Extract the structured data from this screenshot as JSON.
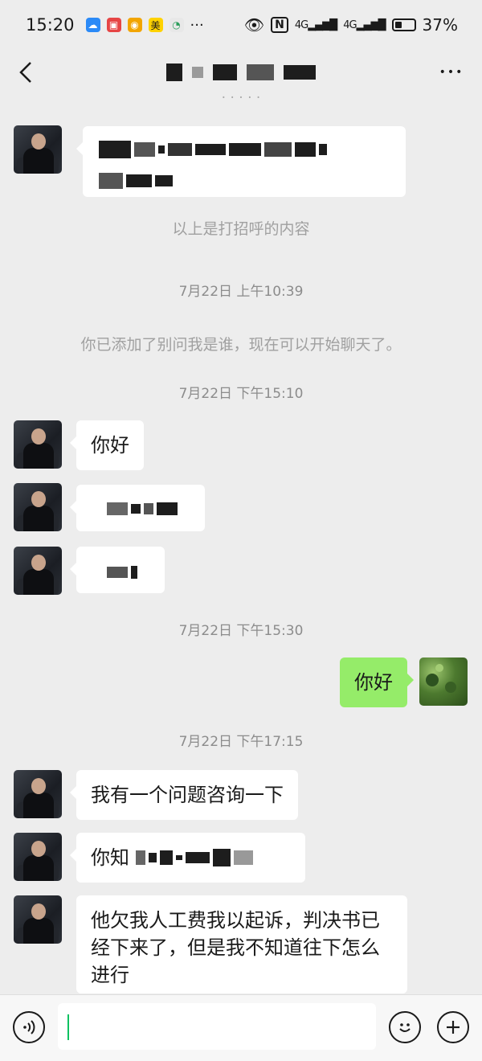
{
  "status_bar": {
    "time": "15:20",
    "app_badge": "美",
    "dots": "···",
    "nfc": "N",
    "signal1": "4G",
    "signal2": "4G",
    "battery_percent": "37%",
    "battery_level": 0.37
  },
  "header": {
    "back_icon": "chevron-left-icon",
    "more_label": "•••"
  },
  "messages": {
    "greeting_note": "以上是打招呼的内容",
    "time_1": "7月22日 上午10:39",
    "system_added": "你已添加了别问我是谁，现在可以开始聊天了。",
    "time_2": "7月22日 下午15:10",
    "msg_hello": "你好",
    "time_3": "7月22日 下午15:30",
    "msg_my_hello": "你好",
    "time_4": "7月22日 下午17:15",
    "msg_question": "我有一个问题咨询一下",
    "msg_know_prefix": "你知",
    "msg_wages": "他欠我人工费我以起诉，判决书已经下来了，但是我不知道往下怎么进行"
  },
  "footer": {
    "voice_icon": "voice-icon",
    "emoji_icon": "emoji-icon",
    "plus_icon": "plus-icon",
    "input_value": ""
  },
  "colors": {
    "background": "#ededed",
    "my_bubble": "#95ec69",
    "their_bubble": "#ffffff",
    "cursor": "#07c160"
  }
}
